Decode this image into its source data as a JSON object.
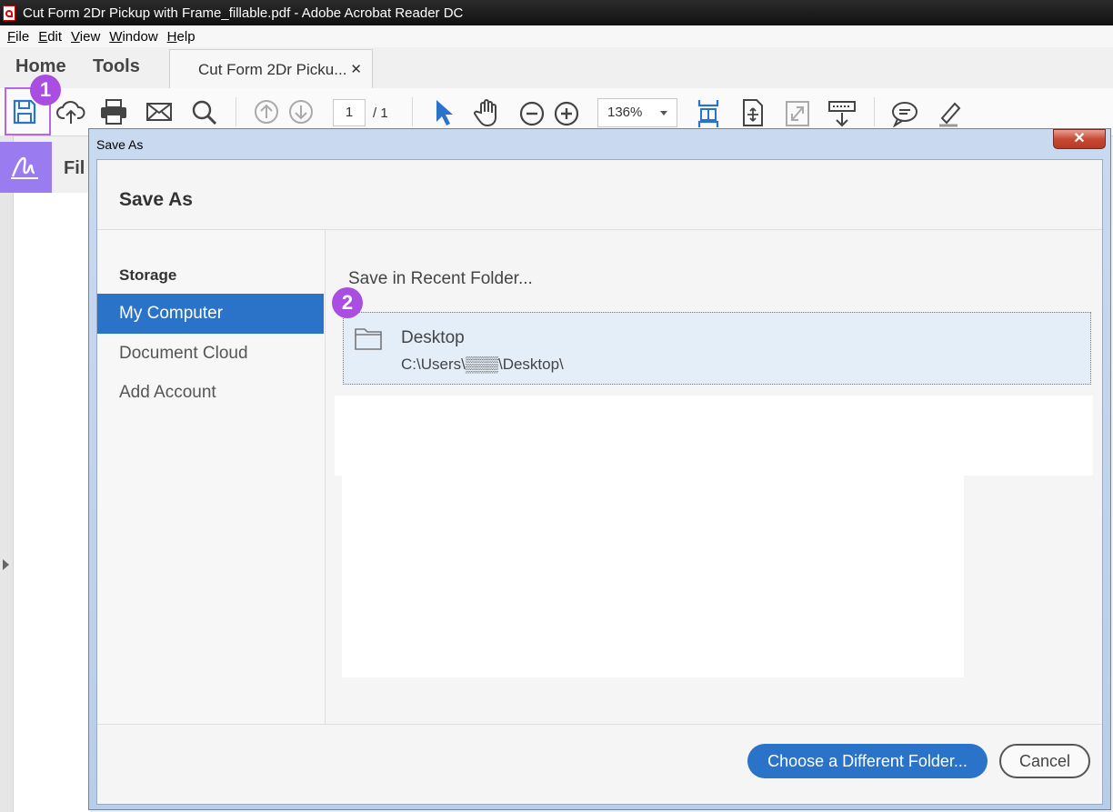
{
  "window": {
    "title": "Cut Form 2Dr Pickup with Frame_fillable.pdf - Adobe Acrobat Reader DC"
  },
  "menu": {
    "items": [
      "File",
      "Edit",
      "View",
      "Window",
      "Help"
    ]
  },
  "tabs": {
    "home": "Home",
    "tools": "Tools",
    "document": "Cut Form 2Dr Picku...",
    "close_glyph": "✕"
  },
  "toolbar": {
    "page_current": "1",
    "page_total": "/ 1",
    "zoom": "136%",
    "icons": [
      "save-icon",
      "cloud-upload-icon",
      "print-icon",
      "email-icon",
      "search-icon",
      "page-up-icon",
      "page-down-icon",
      "select-arrow-icon",
      "hand-icon",
      "zoom-out-icon",
      "zoom-in-icon",
      "fit-page-icon",
      "rotate-page-icon",
      "full-screen-icon",
      "read-mode-icon",
      "comment-icon",
      "highlight-pen-icon"
    ]
  },
  "left_panel": {
    "label": "Fil"
  },
  "badges": {
    "one": "1",
    "two": "2"
  },
  "dialog": {
    "title": "Save As",
    "close_glyph": "✕",
    "heading": "Save As",
    "storage_label": "Storage",
    "storage_items": [
      "My Computer",
      "Document Cloud",
      "Add Account"
    ],
    "recent_label": "Save in Recent Folder...",
    "recent_folder": {
      "name": "Desktop",
      "path": "C:\\Users\\▒▒▒\\Desktop\\"
    },
    "choose_button": "Choose a Different Folder...",
    "cancel_button": "Cancel"
  },
  "colors": {
    "accent": "#2a73c9",
    "badge": "#a94ee0",
    "sign": "#9a7cf0"
  }
}
